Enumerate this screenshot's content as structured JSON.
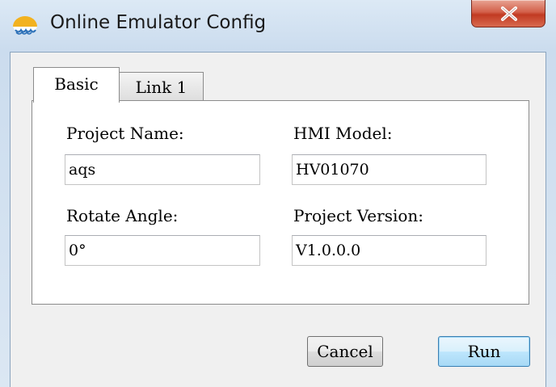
{
  "window": {
    "title": "Online Emulator Config",
    "app_icon": "emulator-app-icon",
    "close_icon": "close-x-icon"
  },
  "tabs": [
    {
      "label": "Basic",
      "selected": true
    },
    {
      "label": "Link 1",
      "selected": false
    }
  ],
  "form": {
    "project_name_label": "Project Name:",
    "project_name_value": "aqs",
    "hmi_model_label": "HMI Model:",
    "hmi_model_value": "HV01070",
    "rotate_angle_label": "Rotate Angle:",
    "rotate_angle_value": "0°",
    "project_version_label": "Project Version:",
    "project_version_value": "V1.0.0.0"
  },
  "buttons": {
    "cancel_label": "Cancel",
    "run_label": "Run"
  },
  "colors": {
    "titlebar": "#cbdcee",
    "close_button": "#c13a22",
    "default_button_border": "#3c7fb1",
    "dialog_background": "#f0f0f0"
  }
}
